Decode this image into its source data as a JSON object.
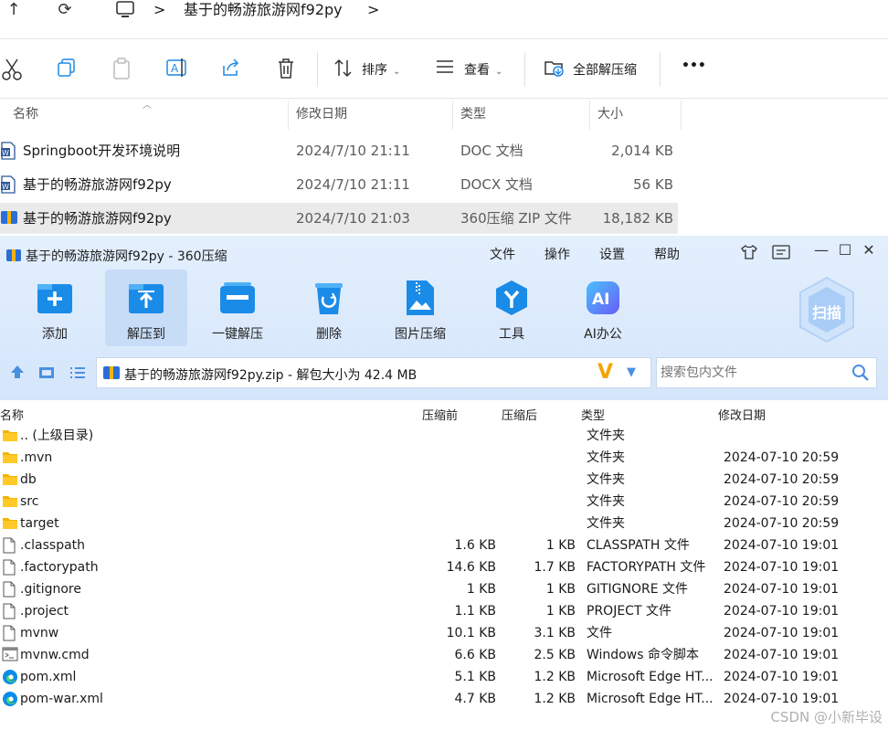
{
  "explorer": {
    "crumb_sep1": ">",
    "folder_title": "基于的畅游旅游网f92py",
    "crumb_sep2": ">",
    "toolbar": {
      "sort_label": "排序",
      "view_label": "查看",
      "extract_all_label": "全部解压缩",
      "more_label": "•••"
    },
    "columns": {
      "name": "名称",
      "modified": "修改日期",
      "type": "类型",
      "size": "大小"
    },
    "rows": [
      {
        "name": "Springboot开发环境说明",
        "modified": "2024/7/10 21:11",
        "type": "DOC 文档",
        "size": "2,014 KB",
        "icon": "word-doc-icon"
      },
      {
        "name": "基于的畅游旅游网f92py",
        "modified": "2024/7/10 21:11",
        "type": "DOCX 文档",
        "size": "56 KB",
        "icon": "word-docx-icon"
      },
      {
        "name": "基于的畅游旅游网f92py",
        "modified": "2024/7/10 21:03",
        "type": "360压缩 ZIP 文件",
        "size": "18,182 KB",
        "icon": "zip-icon",
        "selected": true
      }
    ]
  },
  "zip": {
    "window_title": "基于的畅游旅游网f92py - 360压缩",
    "menu": [
      "文件",
      "操作",
      "设置",
      "帮助"
    ],
    "toolbar": [
      {
        "label": "添加",
        "icon": "add-icon"
      },
      {
        "label": "解压到",
        "icon": "extract-to-icon",
        "selected": true
      },
      {
        "label": "一键解压",
        "icon": "one-click-extract-icon"
      },
      {
        "label": "删除",
        "icon": "delete-icon"
      },
      {
        "label": "图片压缩",
        "icon": "image-compress-icon"
      },
      {
        "label": "工具",
        "icon": "tools-icon"
      },
      {
        "label": "AI办公",
        "icon": "ai-office-icon"
      }
    ],
    "scan_badge": "扫描",
    "address": "基于的畅游旅游网f92py.zip - 解包大小为 42.4 MB",
    "search_placeholder": "搜索包内文件",
    "columns": {
      "name": "名称",
      "before": "压缩前",
      "after": "压缩后",
      "type": "类型",
      "modified": "修改日期"
    },
    "rows": [
      {
        "name": ".. (上级目录)",
        "before": "",
        "after": "",
        "type": "文件夹",
        "modified": "",
        "icon": "folder-icon"
      },
      {
        "name": ".mvn",
        "before": "",
        "after": "",
        "type": "文件夹",
        "modified": "2024-07-10 20:59",
        "icon": "folder-icon"
      },
      {
        "name": "db",
        "before": "",
        "after": "",
        "type": "文件夹",
        "modified": "2024-07-10 20:59",
        "icon": "folder-icon"
      },
      {
        "name": "src",
        "before": "",
        "after": "",
        "type": "文件夹",
        "modified": "2024-07-10 20:59",
        "icon": "folder-icon"
      },
      {
        "name": "target",
        "before": "",
        "after": "",
        "type": "文件夹",
        "modified": "2024-07-10 20:59",
        "icon": "folder-icon"
      },
      {
        "name": ".classpath",
        "before": "1.6 KB",
        "after": "1 KB",
        "type": "CLASSPATH 文件",
        "modified": "2024-07-10 19:01",
        "icon": "file-icon"
      },
      {
        "name": ".factorypath",
        "before": "14.6 KB",
        "after": "1.7 KB",
        "type": "FACTORYPATH 文件",
        "modified": "2024-07-10 19:01",
        "icon": "file-icon"
      },
      {
        "name": ".gitignore",
        "before": "1 KB",
        "after": "1 KB",
        "type": "GITIGNORE 文件",
        "modified": "2024-07-10 19:01",
        "icon": "file-icon"
      },
      {
        "name": ".project",
        "before": "1.1 KB",
        "after": "1 KB",
        "type": "PROJECT 文件",
        "modified": "2024-07-10 19:01",
        "icon": "file-icon"
      },
      {
        "name": "mvnw",
        "before": "10.1 KB",
        "after": "3.1 KB",
        "type": "文件",
        "modified": "2024-07-10 19:01",
        "icon": "file-icon"
      },
      {
        "name": "mvnw.cmd",
        "before": "6.6 KB",
        "after": "2.5 KB",
        "type": "Windows 命令脚本",
        "modified": "2024-07-10 19:01",
        "icon": "cmd-script-icon"
      },
      {
        "name": "pom.xml",
        "before": "5.1 KB",
        "after": "1.2 KB",
        "type": "Microsoft Edge HT...",
        "modified": "2024-07-10 19:01",
        "icon": "edge-icon"
      },
      {
        "name": "pom-war.xml",
        "before": "4.7 KB",
        "after": "1.2 KB",
        "type": "Microsoft Edge HT...",
        "modified": "2024-07-10 19:01",
        "icon": "edge-icon"
      }
    ]
  },
  "watermark": "CSDN @小新毕设",
  "colors": {
    "accent_blue": "#1e88e5",
    "header_bg": "#dbe9fb",
    "selected_row": "#eaeaea",
    "folder_yellow": "#f4b400",
    "version_orange": "#f2a400"
  }
}
